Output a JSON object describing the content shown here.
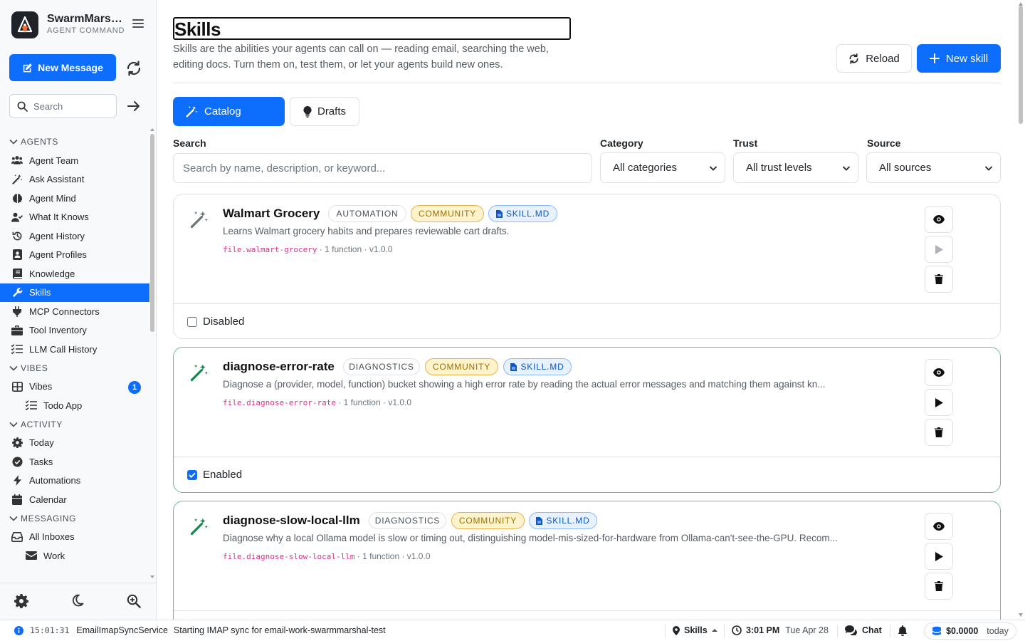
{
  "brand": {
    "name": "SwarmMarshal",
    "subtitle": "AGENT COMMAND"
  },
  "sidebar": {
    "new_message_label": "New Message",
    "search_placeholder": "Search",
    "sections": {
      "agents": "AGENTS",
      "vibes": "VIBES",
      "activity": "ACTIVITY",
      "messaging": "MESSAGING"
    },
    "agents_items": [
      "Agent Team",
      "Ask Assistant",
      "Agent Mind",
      "What It Knows",
      "Agent History",
      "Agent Profiles",
      "Knowledge",
      "Skills",
      "MCP Connectors",
      "Tool Inventory",
      "LLM Call History"
    ],
    "vibes_items": {
      "vibes": "Vibes",
      "vibes_badge": "1",
      "todo_app": "Todo App"
    },
    "activity_items": [
      "Today",
      "Tasks",
      "Automations",
      "Calendar"
    ],
    "messaging_items": {
      "all_inboxes": "All Inboxes",
      "work": "Work"
    },
    "active_item": "Skills"
  },
  "header": {
    "title": "Skills",
    "description": "Skills are the abilities your agents can call on — reading email, searching the web, editing docs. Turn them on, test them, or let your agents build new ones.",
    "reload_label": "Reload",
    "new_skill_label": "New skill"
  },
  "tabs": {
    "catalog": "Catalog",
    "drafts": "Drafts"
  },
  "filters": {
    "search_label": "Search",
    "search_placeholder": "Search by name, description, or keyword...",
    "category_label": "Category",
    "category_value": "All categories",
    "trust_label": "Trust",
    "trust_value": "All trust levels",
    "source_label": "Source",
    "source_value": "All sources"
  },
  "skills": [
    {
      "name": "Walmart Grocery",
      "category": "AUTOMATION",
      "trust": "COMMUNITY",
      "source": "SKILL.MD",
      "description": "Learns Walmart grocery habits and prepares reviewable cart drafts.",
      "id": "file.walmart-grocery",
      "meta": " · 1 function · v1.0.0",
      "status": "Disabled",
      "enabled": false
    },
    {
      "name": "diagnose-error-rate",
      "category": "DIAGNOSTICS",
      "trust": "COMMUNITY",
      "source": "SKILL.MD",
      "description": "Diagnose a (provider, model, function) bucket showing a high error rate by reading the actual error messages and matching them against kn...",
      "id": "file.diagnose-error-rate",
      "meta": " · 1 function · v1.0.0",
      "status": "Enabled",
      "enabled": true
    },
    {
      "name": "diagnose-slow-local-llm",
      "category": "DIAGNOSTICS",
      "trust": "COMMUNITY",
      "source": "SKILL.MD",
      "description": "Diagnose why a local Ollama model is slow or timing out, distinguishing model-mis-sized-for-hardware from Ollama-can't-see-the-GPU. Recom...",
      "id": "file.diagnose-slow-local-llm",
      "meta": " · 1 function · v1.0.0",
      "status": "",
      "enabled": true
    }
  ],
  "statusbar": {
    "time": "15:01:31",
    "service": "EmailImapSyncService",
    "message": "Starting IMAP sync for email-work-swarmmarshal-test",
    "location": "Skills",
    "clock": "3:01 PM",
    "date": "Tue Apr 28",
    "chat_label": "Chat",
    "cost": "$0.0000",
    "cost_period": "today"
  },
  "colors": {
    "accent": "#0d6efd",
    "community": "#997404",
    "enabled_border": "#75b798",
    "code": "#d63384"
  }
}
